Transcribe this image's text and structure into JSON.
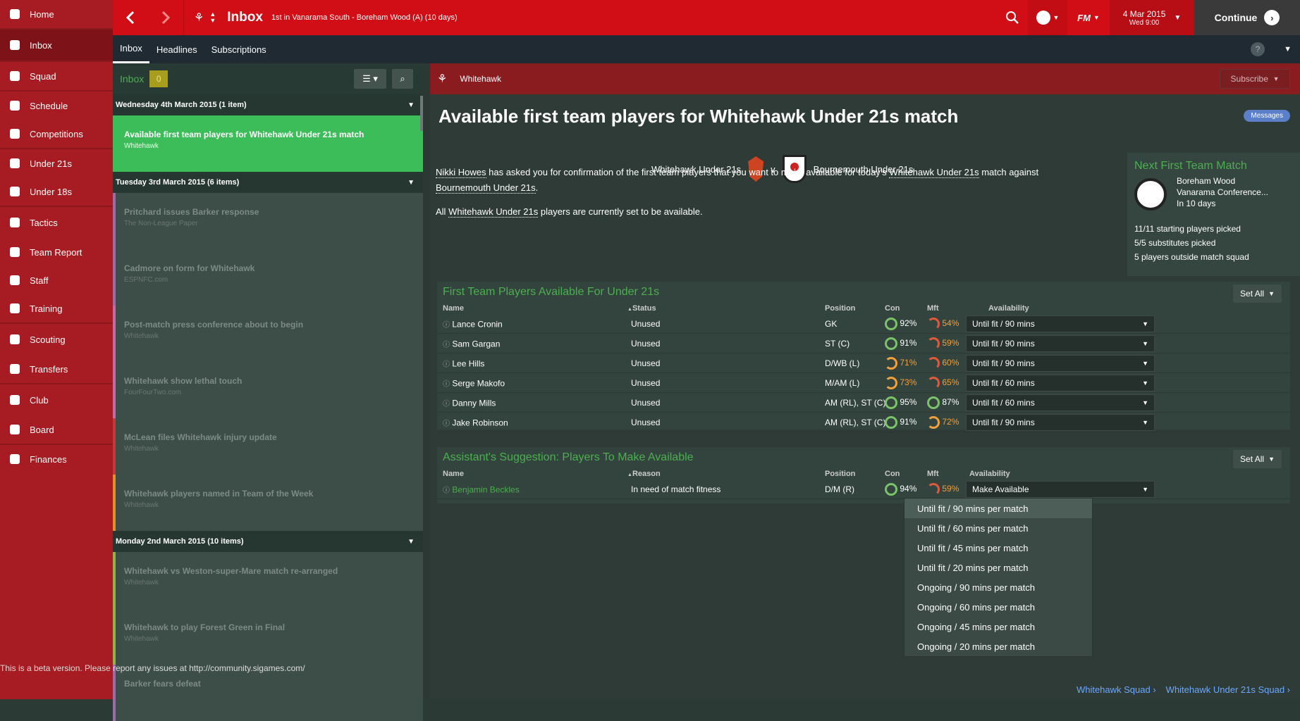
{
  "sidebar": {
    "items": [
      {
        "label": "Home",
        "icon": "home-icon"
      },
      {
        "label": "Inbox",
        "icon": "inbox-icon"
      },
      {
        "label": "Squad",
        "icon": "squad-icon"
      },
      {
        "label": "Schedule",
        "icon": "schedule-icon"
      },
      {
        "label": "Competitions",
        "icon": "trophy-icon"
      },
      {
        "label": "Under 21s",
        "icon": "under21-icon"
      },
      {
        "label": "Under 18s",
        "icon": "under18-icon"
      },
      {
        "label": "Tactics",
        "icon": "tactics-icon"
      },
      {
        "label": "Team Report",
        "icon": "report-icon"
      },
      {
        "label": "Staff",
        "icon": "staff-icon"
      },
      {
        "label": "Training",
        "icon": "training-icon"
      },
      {
        "label": "Scouting",
        "icon": "search-icon"
      },
      {
        "label": "Transfers",
        "icon": "transfers-icon"
      },
      {
        "label": "Club",
        "icon": "club-icon"
      },
      {
        "label": "Board",
        "icon": "board-icon"
      },
      {
        "label": "Finances",
        "icon": "finances-icon"
      }
    ]
  },
  "topbar": {
    "title": "Inbox",
    "subtitle": "1st in Vanarama South - Boreham Wood (A) (10 days)",
    "date_main": "4 Mar 2015",
    "date_sub": "Wed 9:00",
    "continue_label": "Continue",
    "fm_label": "FM"
  },
  "tabs": [
    "Inbox",
    "Headlines",
    "Subscriptions"
  ],
  "inbox": {
    "label": "Inbox",
    "count": "0",
    "groups": [
      {
        "head": "Wednesday 4th March 2015 (1 item)",
        "messages": [
          {
            "title": "Available first team players for Whitehawk Under 21s match",
            "source": "Whitehawk",
            "selected": true,
            "color": "#3dbd5a"
          }
        ]
      },
      {
        "head": "Tuesday 3rd March 2015 (6 items)",
        "messages": [
          {
            "title": "Pritchard issues Barker response",
            "source": "The Non-League Paper",
            "color": "#9c6aa8"
          },
          {
            "title": "Cadmore on form for Whitehawk",
            "source": "ESPNFC.com",
            "color": "#9c6aa8"
          },
          {
            "title": "Post-match press conference about to begin",
            "source": "Whitehawk",
            "color": "#c36aa8"
          },
          {
            "title": "Whitehawk show lethal touch",
            "source": "FourFourTwo.com",
            "color": "#c36aa8"
          },
          {
            "title": "McLean files Whitehawk injury update",
            "source": "Whitehawk",
            "color": "#c23b3b"
          },
          {
            "title": "Whitehawk players named in Team of the Week",
            "source": "Whitehawk",
            "color": "#e0902a"
          }
        ]
      },
      {
        "head": "Monday 2nd March 2015 (10 items)",
        "messages": [
          {
            "title": "Whitehawk vs Weston-super-Mare match re-arranged",
            "source": "Whitehawk",
            "color": "#8ab54a"
          },
          {
            "title": "Whitehawk to play Forest Green in Final",
            "source": "Whitehawk",
            "color": "#8ab54a"
          },
          {
            "title": "Barker fears defeat",
            "source": "",
            "color": "#9c6aa8"
          }
        ]
      }
    ]
  },
  "beta_notice": "This is a beta version. Please report any issues at http://community.sigames.com/",
  "main": {
    "club": "Whitehawk",
    "subscribe_label": "Subscribe",
    "title": "Available first team players for Whitehawk Under 21s match",
    "messages_label": "Messages",
    "home_team": "Whitehawk Under 21s",
    "vs": "v",
    "away_team": "Bournemouth Under 21s",
    "para1_a": "Nikki Howes",
    "para1_b": " has asked you for confirmation of the first team players that you want to make available for today's ",
    "para1_c": "Whitehawk Under 21s",
    "para1_d": " match against",
    "para1_e": "Bournemouth Under 21s",
    "para1_f": ".",
    "para2_a": "All ",
    "para2_b": "Whitehawk Under 21s",
    "para2_c": " players are currently set to be available.",
    "next_match": {
      "title": "Next First Team Match",
      "opponent": "Boreham Wood",
      "competition": "Vanarama Conference...",
      "when": "In 10 days",
      "line1": "11/11 starting players picked",
      "line2": "5/5 substitutes picked",
      "line3": "5 players outside match squad"
    },
    "section1": {
      "title": "First Team Players Available For Under 21s",
      "set_all": "Set All",
      "cols": {
        "name": "Name",
        "status": "Status",
        "position": "Position",
        "con": "Con",
        "mft": "Mft",
        "availability": "Availability"
      },
      "rows": [
        {
          "name": "Lance Cronin",
          "status": "Unused",
          "pos": "GK",
          "con": "92%",
          "mft": "54%",
          "avail": "Until fit / 90 mins"
        },
        {
          "name": "Sam Gargan",
          "status": "Unused",
          "pos": "ST (C)",
          "con": "91%",
          "mft": "59%",
          "avail": "Until fit / 90 mins"
        },
        {
          "name": "Lee Hills",
          "status": "Unused",
          "pos": "D/WB (L)",
          "con": "71%",
          "mft": "60%",
          "avail": "Until fit / 90 mins"
        },
        {
          "name": "Serge Makofo",
          "status": "Unused",
          "pos": "M/AM (L)",
          "con": "73%",
          "mft": "65%",
          "avail": "Until fit / 60 mins"
        },
        {
          "name": "Danny Mills",
          "status": "Unused",
          "pos": "AM (RL), ST (C)",
          "con": "95%",
          "mft": "87%",
          "avail": "Until fit / 60 mins"
        },
        {
          "name": "Jake Robinson",
          "status": "Unused",
          "pos": "AM (RL), ST (C)",
          "con": "91%",
          "mft": "72%",
          "avail": "Until fit / 90 mins"
        }
      ]
    },
    "section2": {
      "title": "Assistant's Suggestion: Players To Make Available",
      "set_all": "Set All",
      "cols": {
        "name": "Name",
        "reason": "Reason",
        "position": "Position",
        "con": "Con",
        "mft": "Mft",
        "availability": "Availability"
      },
      "rows": [
        {
          "name": "Benjamin Beckles",
          "reason": "In need of match fitness",
          "pos": "D/M (R)",
          "con": "94%",
          "mft": "59%",
          "avail": "Make Available"
        }
      ]
    },
    "dropdown_options": [
      "Until fit / 90 mins per match",
      "Until fit / 60 mins per match",
      "Until fit / 45 mins per match",
      "Until fit / 20 mins per match",
      "Ongoing / 90 mins per match",
      "Ongoing / 60 mins per match",
      "Ongoing / 45 mins per match",
      "Ongoing / 20 mins per match"
    ],
    "footer_link1": "Whitehawk Squad",
    "footer_link2": "Whitehawk Under 21s Squad"
  }
}
